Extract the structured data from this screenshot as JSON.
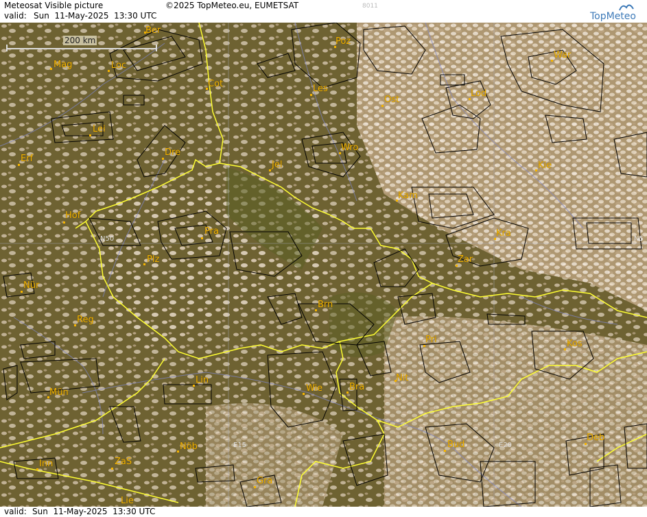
{
  "header": {
    "title": "Meteosat Visible picture",
    "copyright": "©2025 TopMeteo.eu, EUMETSAT",
    "code": "8011",
    "valid_label": "valid:",
    "valid_time": "Sun  11-May-2025  13:30 UTC",
    "logo": "TopMeteo"
  },
  "footer": {
    "valid_label": "valid:",
    "valid_time": "Sun  11-May-2025  13:30 UTC"
  },
  "scale": {
    "label": "200 km"
  },
  "grid_labels": {
    "n50_left": "N50",
    "n50_right": "N5",
    "e15": "E15",
    "e20": "E20"
  },
  "cities": [
    {
      "key": "ber",
      "name": "Ber"
    },
    {
      "key": "mag",
      "name": "Mag"
    },
    {
      "key": "loc",
      "name": "Loc"
    },
    {
      "key": "cot",
      "name": "Cot"
    },
    {
      "key": "poz",
      "name": "Poz"
    },
    {
      "key": "war",
      "name": "War"
    },
    {
      "key": "les",
      "name": "Les"
    },
    {
      "key": "ost",
      "name": "Ost"
    },
    {
      "key": "lod",
      "name": "Lod"
    },
    {
      "key": "lei",
      "name": "Lei"
    },
    {
      "key": "dre",
      "name": "Dre"
    },
    {
      "key": "wro",
      "name": "Wro"
    },
    {
      "key": "erf",
      "name": "Erf"
    },
    {
      "key": "jel",
      "name": "Jel"
    },
    {
      "key": "kie",
      "name": "Kie"
    },
    {
      "key": "kam",
      "name": "Kam"
    },
    {
      "key": "hof",
      "name": "Hof"
    },
    {
      "key": "pra",
      "name": "Pra"
    },
    {
      "key": "kra",
      "name": "Kra"
    },
    {
      "key": "plz",
      "name": "Plz"
    },
    {
      "key": "zar",
      "name": "Zar"
    },
    {
      "key": "nur",
      "name": "Nür"
    },
    {
      "key": "brn",
      "name": "Brn"
    },
    {
      "key": "reg",
      "name": "Reg"
    },
    {
      "key": "pri",
      "name": "Pri"
    },
    {
      "key": "kos",
      "name": "Kos"
    },
    {
      "key": "lin",
      "name": "Lin"
    },
    {
      "key": "nit",
      "name": "Nit"
    },
    {
      "key": "wie",
      "name": "Wie"
    },
    {
      "key": "bra",
      "name": "Bra"
    },
    {
      "key": "mun",
      "name": "Mün"
    },
    {
      "key": "bud",
      "name": "Bud"
    },
    {
      "key": "deb",
      "name": "Deb"
    },
    {
      "key": "nob",
      "name": "Nöb"
    },
    {
      "key": "inn",
      "name": "Inn"
    },
    {
      "key": "zas",
      "name": "ZaS"
    },
    {
      "key": "gra",
      "name": "Gra"
    },
    {
      "key": "lie",
      "name": "Lie"
    }
  ],
  "colors": {
    "label": "#f5b400",
    "border": "#ffff33",
    "airspace": "#000000",
    "rivers": "#7f86c9"
  }
}
